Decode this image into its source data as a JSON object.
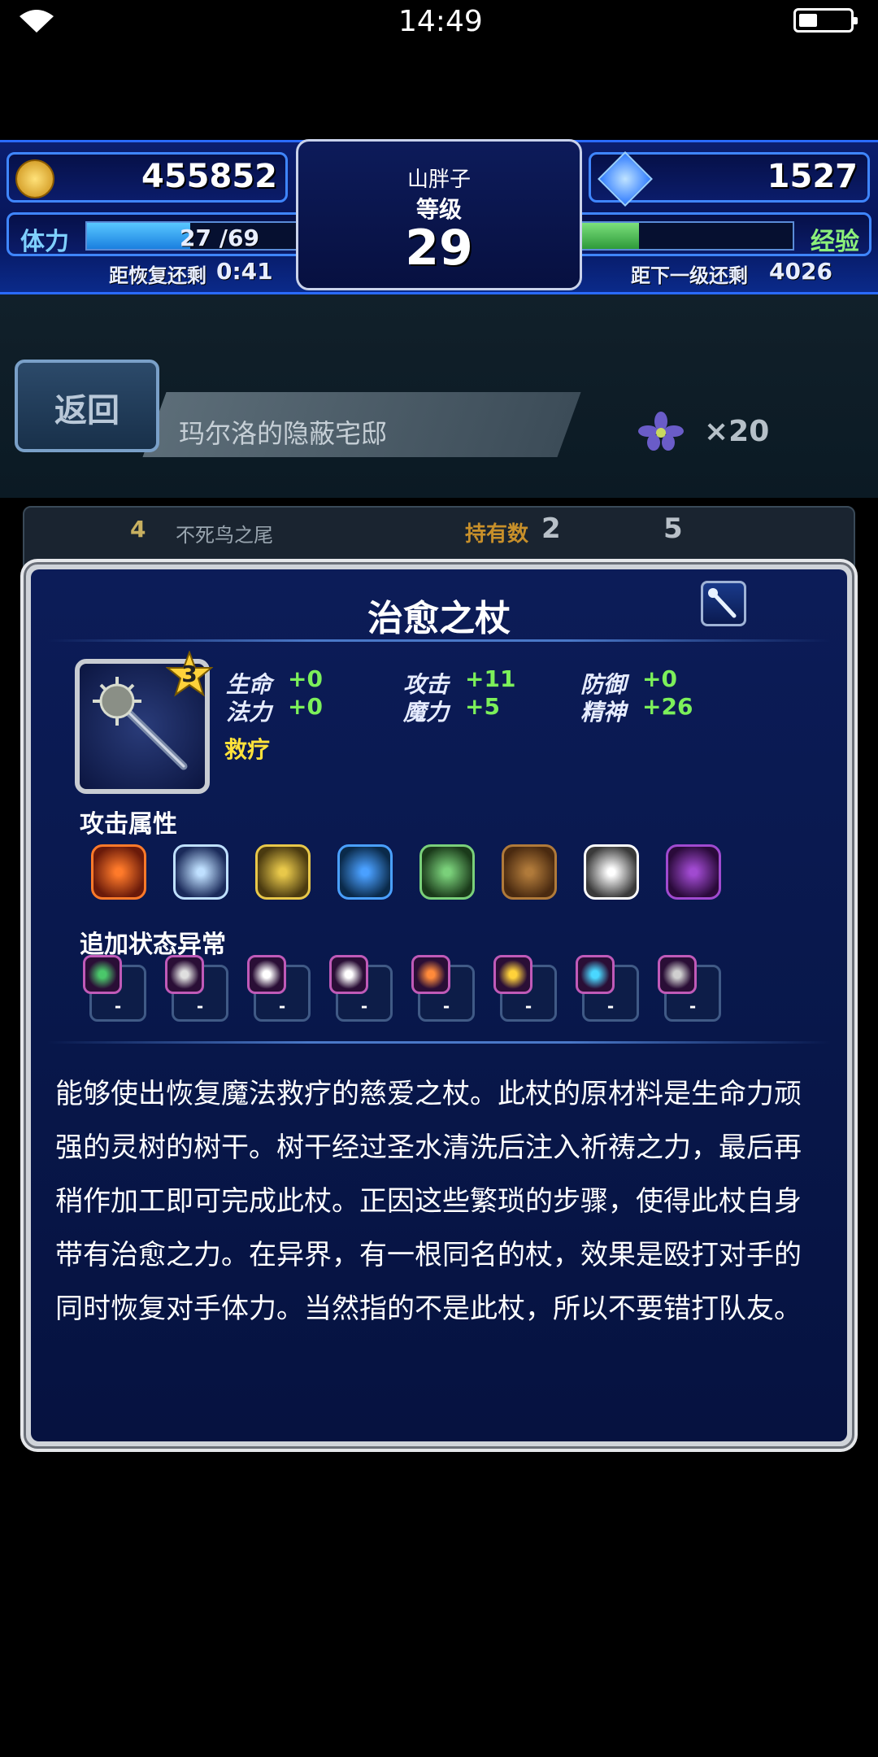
{
  "status_bar": {
    "time": "14:49"
  },
  "hud": {
    "gil": "455852",
    "gems": "1527",
    "player_name": "山胖子",
    "level_label": "等级",
    "level": "29",
    "stamina_label": "体力",
    "stamina": "27 /69",
    "stamina_fraction": 0.39,
    "stamina_timer_label": "距恢复还剩",
    "stamina_timer": "0:41",
    "exp_label": "经验",
    "exp_fraction": 0.42,
    "exp_remaining_label": "距下一级还剩",
    "exp_remaining": "4026"
  },
  "scene": {
    "back_label": "返回",
    "location": "玛尔洛的隐蔽宅邸",
    "item_count": "×20",
    "list_row": {
      "stars": "4",
      "name": "不死鸟之尾",
      "owned_label": "持有数",
      "owned": "2",
      "cost": "5"
    }
  },
  "item": {
    "name": "治愈之杖",
    "rarity": "3",
    "stats": [
      {
        "name": "生命",
        "value": "+0"
      },
      {
        "name": "攻击",
        "value": "+11"
      },
      {
        "name": "防御",
        "value": "+0"
      },
      {
        "name": "法力",
        "value": "+0"
      },
      {
        "name": "魔力",
        "value": "+5"
      },
      {
        "name": "精神",
        "value": "+26"
      }
    ],
    "ability": "救疗",
    "element_label": "攻击属性",
    "elements": [
      "fire-icon",
      "ice-icon",
      "thunder-icon",
      "water-icon",
      "wind-icon",
      "earth-icon",
      "light-icon",
      "dark-icon"
    ],
    "status_label": "追加状态异常",
    "status_effects": [
      {
        "icon": "poison-icon",
        "value": "-"
      },
      {
        "icon": "blind-icon",
        "value": "-"
      },
      {
        "icon": "sleep-icon",
        "value": "-"
      },
      {
        "icon": "silence-icon",
        "value": "-"
      },
      {
        "icon": "paralysis-icon",
        "value": "-"
      },
      {
        "icon": "confusion-icon",
        "value": "-"
      },
      {
        "icon": "disease-icon",
        "value": "-"
      },
      {
        "icon": "petrify-icon",
        "value": "-"
      }
    ],
    "description": "能够使出恢复魔法救疗的慈爱之杖。此杖的原材料是生命力顽强的灵树的树干。树干经过圣水清洗后注入祈祷之力，最后再稍作加工即可完成此杖。正因这些繁琐的步骤，使得此杖自身带有治愈之力。在异界，有一根同名的杖，效果是殴打对手的同时恢复对手体力。当然指的不是此杖，所以不要错打队友。"
  },
  "colors": {
    "stat_value": "#7cf05a",
    "ability": "#ffe23a",
    "hud_blue": "#2a6bff"
  }
}
